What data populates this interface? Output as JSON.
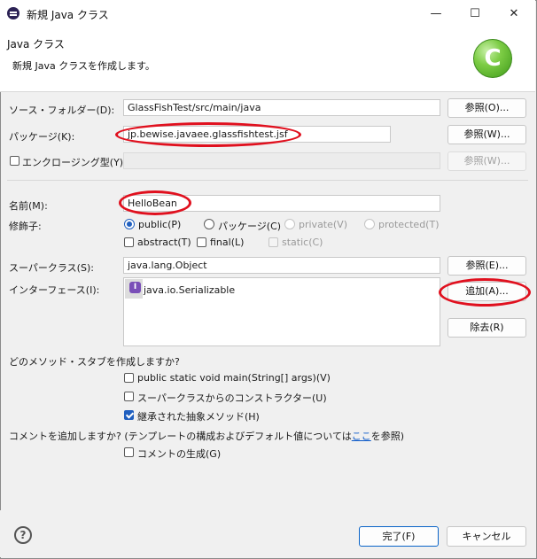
{
  "window": {
    "title": "新規 Java クラス"
  },
  "title_buttons": {
    "minimize": "—",
    "maximize": "☐",
    "close": "✕"
  },
  "header": {
    "title": "Java クラス",
    "description": "新規 Java クラスを作成します。"
  },
  "source_folder": {
    "label": "ソース・フォルダー(D):",
    "value": "GlassFishTest/src/main/java",
    "browse": "参照(O)..."
  },
  "package": {
    "label": "パッケージ(K):",
    "value": "jp.bewise.javaee.glassfishtest.jsf",
    "browse": "参照(W)..."
  },
  "enclosing": {
    "label": "エンクロージング型(Y):",
    "value": "",
    "browse": "参照(W)..."
  },
  "name": {
    "label": "名前(M):",
    "value": "HelloBean"
  },
  "modifiers": {
    "label": "修飾子:",
    "public": "public(P)",
    "package": "パッケージ(C)",
    "private": "private(V)",
    "protected": "protected(T)",
    "abstract": "abstract(T)",
    "final": "final(L)",
    "static": "static(C)"
  },
  "superclass": {
    "label": "スーパークラス(S):",
    "value": "java.lang.Object",
    "browse": "参照(E)..."
  },
  "interfaces": {
    "label": "インターフェース(I):",
    "items": [
      "java.io.Serializable"
    ],
    "add": "追加(A)...",
    "remove": "除去(R)"
  },
  "stubs": {
    "question": "どのメソッド・スタブを作成しますか?",
    "main": "public static void main(String[] args)(V)",
    "constructors": "スーパークラスからのコンストラクター(U)",
    "inherited": "継承された抽象メソッド(H)"
  },
  "comments": {
    "question_prefix": "コメントを追加しますか? (テンプレートの構成およびデフォルト値については",
    "link": "ここ",
    "question_suffix": "を参照)",
    "generate": "コメントの生成(G)"
  },
  "footer": {
    "help": "?",
    "finish": "完了(F)",
    "cancel": "キャンセル"
  },
  "colors": {
    "highlight": "#e0101e",
    "accent": "#1f5fbf"
  }
}
